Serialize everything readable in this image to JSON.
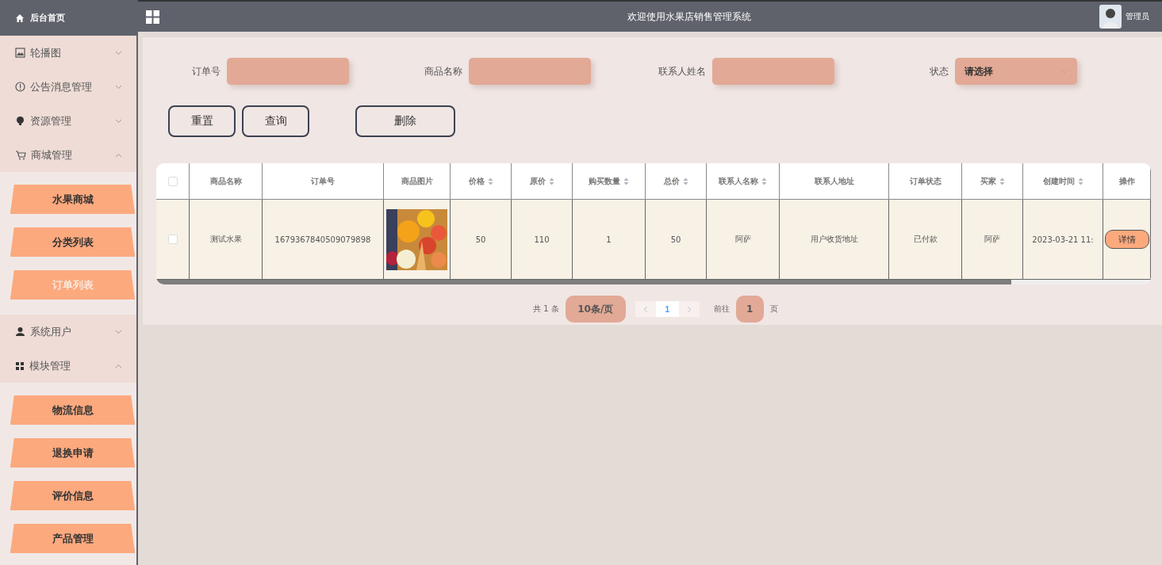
{
  "sidebar": {
    "home": "后台首页",
    "groups": [
      {
        "label": "轮播图",
        "expanded": false
      },
      {
        "label": "公告消息管理",
        "expanded": false
      },
      {
        "label": "资源管理",
        "expanded": false
      },
      {
        "label": "商城管理",
        "expanded": true,
        "children": [
          {
            "label": "水果商城",
            "selected": false
          },
          {
            "label": "分类列表",
            "selected": false
          },
          {
            "label": "订单列表",
            "selected": true
          }
        ]
      },
      {
        "label": "系统用户",
        "expanded": false
      },
      {
        "label": "模块管理",
        "expanded": true,
        "children": [
          {
            "label": "物流信息",
            "selected": false
          },
          {
            "label": "退换申请",
            "selected": false
          },
          {
            "label": "评价信息",
            "selected": false
          },
          {
            "label": "产品管理",
            "selected": false
          }
        ]
      }
    ]
  },
  "header": {
    "title": "欢迎使用水果店销售管理系统",
    "user": "管理员"
  },
  "filters": [
    {
      "label": "订单号",
      "kind": "input"
    },
    {
      "label": "商品名称",
      "kind": "input"
    },
    {
      "label": "联系人姓名",
      "kind": "input"
    },
    {
      "label": "状态",
      "kind": "select",
      "value": "请选择"
    }
  ],
  "buttons": [
    "重置",
    "查询",
    "删除"
  ],
  "table": {
    "all_checked": false,
    "columns": [
      {
        "label": "商品名称",
        "sortable": false
      },
      {
        "label": "订单号",
        "sortable": false
      },
      {
        "label": "商品图片",
        "sortable": false
      },
      {
        "label": "价格",
        "sortable": true
      },
      {
        "label": "原价",
        "sortable": true
      },
      {
        "label": "购买数量",
        "sortable": true
      },
      {
        "label": "总价",
        "sortable": true
      },
      {
        "label": "联系人名称",
        "sortable": true
      },
      {
        "label": "联系人地址",
        "sortable": false
      },
      {
        "label": "订单状态",
        "sortable": false
      },
      {
        "label": "买家",
        "sortable": true
      },
      {
        "label": "创建时间",
        "sortable": true
      },
      {
        "label": "操作",
        "sortable": false
      }
    ],
    "rows": [
      {
        "checked": false,
        "cells": [
          {
            "kind": "text",
            "text": "测试水果"
          },
          {
            "kind": "text",
            "text": "1679367840509079898"
          },
          {
            "kind": "picture"
          },
          {
            "kind": "text",
            "text": "50"
          },
          {
            "kind": "text",
            "text": "110"
          },
          {
            "kind": "text",
            "text": "1"
          },
          {
            "kind": "text",
            "text": "50"
          },
          {
            "kind": "text",
            "text": "阿萨"
          },
          {
            "kind": "text",
            "text": "用户收货地址"
          },
          {
            "kind": "text",
            "text": "已付款"
          },
          {
            "kind": "text",
            "text": "阿萨"
          },
          {
            "kind": "text",
            "text": "2023-03-21 11:"
          },
          {
            "kind": "button",
            "text": "详情"
          }
        ]
      }
    ]
  },
  "pagination": {
    "total": "共 1 条",
    "page_size": "10条/页",
    "pages": [
      {
        "label": "1",
        "selected": true
      }
    ],
    "goto_label": "前往",
    "goto_value": "1",
    "goto_suffix": "页"
  }
}
